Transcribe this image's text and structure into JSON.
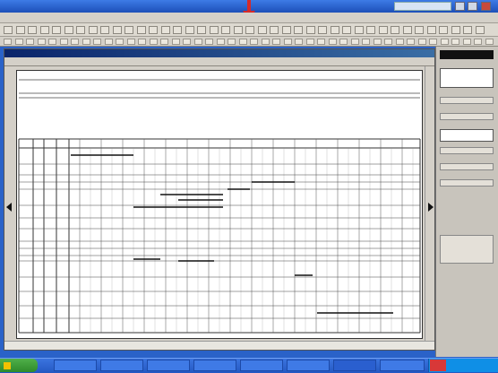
{
  "window": {
    "title": ""
  },
  "menubar": {
    "items": [
      "",
      "",
      "",
      "",
      "",
      "",
      "",
      ""
    ]
  },
  "document": {
    "title": "",
    "page_heading": "",
    "left_header": "",
    "right_header": ""
  },
  "right_panel": {
    "labels": [
      "",
      "",
      "",
      ""
    ]
  },
  "taskbar": {
    "start_label": ""
  },
  "colors": {
    "accent": "#d42a2a",
    "titlebar": "#2a62c8",
    "doc_titlebar": "#0a246a",
    "taskbar": "#2458c2",
    "start": "#3a9a34"
  },
  "icons": [
    "arrow-down-icon",
    "minimize-icon",
    "maximize-icon",
    "close-icon",
    "scroll-left-icon",
    "scroll-right-icon",
    "windows-logo-icon"
  ]
}
